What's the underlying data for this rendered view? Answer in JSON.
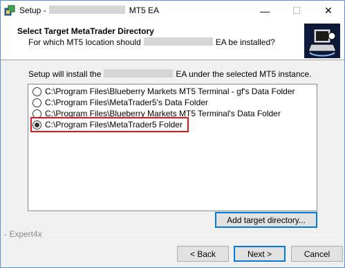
{
  "window": {
    "title_prefix": "Setup -",
    "title_suffix": "MT5 EA",
    "controls": {
      "minimize": "—",
      "maximize": "☐",
      "close": "✕"
    }
  },
  "header": {
    "title": "Select Target MetaTrader Directory",
    "subtitle_prefix": "For which MT5 location should",
    "subtitle_suffix": "EA be installed?",
    "logo_icon": "installer-computer-icon"
  },
  "content": {
    "intro_prefix": "Setup will install the",
    "intro_suffix": "EA under the selected MT5 instance.",
    "options": [
      {
        "label": "C:\\Program Files\\Blueberry Markets MT5 Terminal - gf's Data Folder",
        "checked": false
      },
      {
        "label": "C:\\Program Files\\MetaTrader5's Data Folder",
        "checked": false
      },
      {
        "label": "C:\\Program Files\\Blueberry Markets MT5 Terminal's Data Folder",
        "checked": false
      },
      {
        "label": "C:\\Program Files\\MetaTrader5 Folder",
        "checked": true
      }
    ],
    "add_button": "Add target directory..."
  },
  "footer": {
    "brand": "- Expert4x",
    "back": "< Back",
    "next": "Next >",
    "cancel": "Cancel"
  },
  "colors": {
    "highlight": "#e0141e",
    "focus": "#0078d7",
    "logo_bg": "#0e1a3c"
  }
}
